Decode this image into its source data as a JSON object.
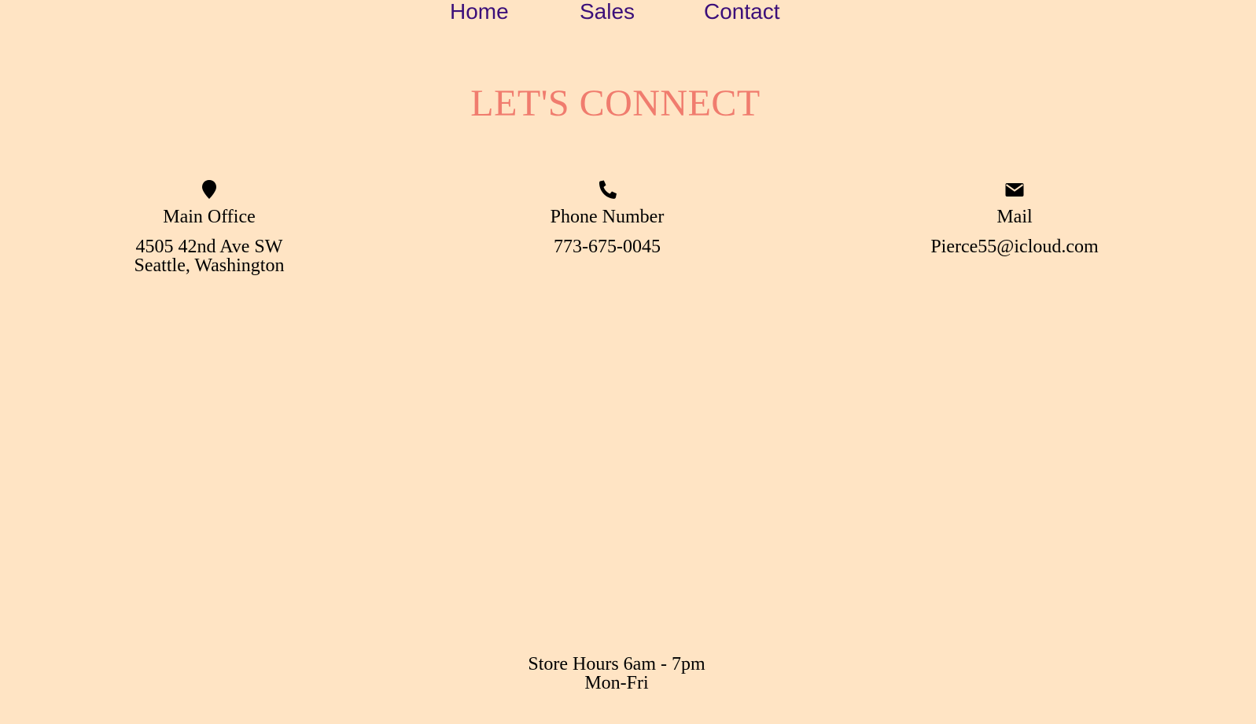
{
  "nav": {
    "home": "Home",
    "sales": "Sales",
    "contact": "Contact"
  },
  "page_title": "LET'S CONNECT",
  "contact": {
    "office": {
      "icon": "map-pin-icon",
      "label": "Main Office",
      "address_line1": "4505 42nd Ave SW",
      "address_line2": "Seattle, Washington"
    },
    "phone": {
      "icon": "phone-icon",
      "label": "Phone Number",
      "value": "773-675-0045"
    },
    "mail": {
      "icon": "envelope-icon",
      "label": "Mail",
      "value": "Pierce55@icloud.com"
    }
  },
  "hours": {
    "line1": "Store Hours 6am - 7pm",
    "line2": "Mon-Fri"
  },
  "colors": {
    "background": "#ffe4c4",
    "nav_link": "#3b0f7a",
    "title": "#f07c6e",
    "text": "#000000"
  }
}
